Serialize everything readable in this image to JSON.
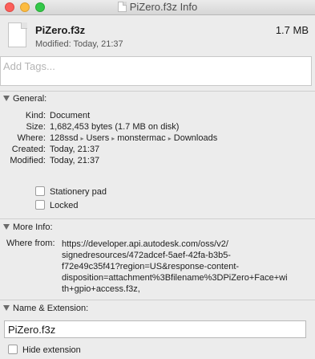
{
  "window": {
    "title": "PiZero.f3z Info"
  },
  "file": {
    "name": "PiZero.f3z",
    "size": "1.7 MB",
    "modified": "Modified: Today, 21:37"
  },
  "tags": {
    "placeholder": "Add Tags..."
  },
  "general": {
    "header": "General:",
    "rows": [
      {
        "label": "Kind:",
        "value": "Document"
      },
      {
        "label": "Size:",
        "value": "1,682,453 bytes (1.7 MB on disk)"
      },
      {
        "label": "Where:",
        "path": [
          "128ssd",
          "Users",
          "monstermac",
          "Downloads"
        ],
        "separator": "▸"
      },
      {
        "label": "Created:",
        "value": "Today, 21:37"
      },
      {
        "label": "Modified:",
        "value": "Today, 21:37"
      }
    ],
    "stationery_pad": {
      "label": "Stationery pad",
      "checked": false
    },
    "locked": {
      "label": "Locked",
      "checked": false
    }
  },
  "more_info": {
    "header": "More Info:",
    "where_from_label": "Where from:",
    "where_from_lines": [
      "https://developer.api.autodesk.com/oss/v2/",
      "signedresources/472adcef-5aef-42fa-b3b5-",
      "f72e49c35f41?region=US&response-content-",
      "disposition=attachment%3Bfilename%3DPiZero+Face+wi",
      "th+gpio+access.f3z,"
    ]
  },
  "name_extension": {
    "header": "Name & Extension:",
    "value": "PiZero.f3z",
    "hide_extension": {
      "label": "Hide extension",
      "checked": false
    }
  }
}
